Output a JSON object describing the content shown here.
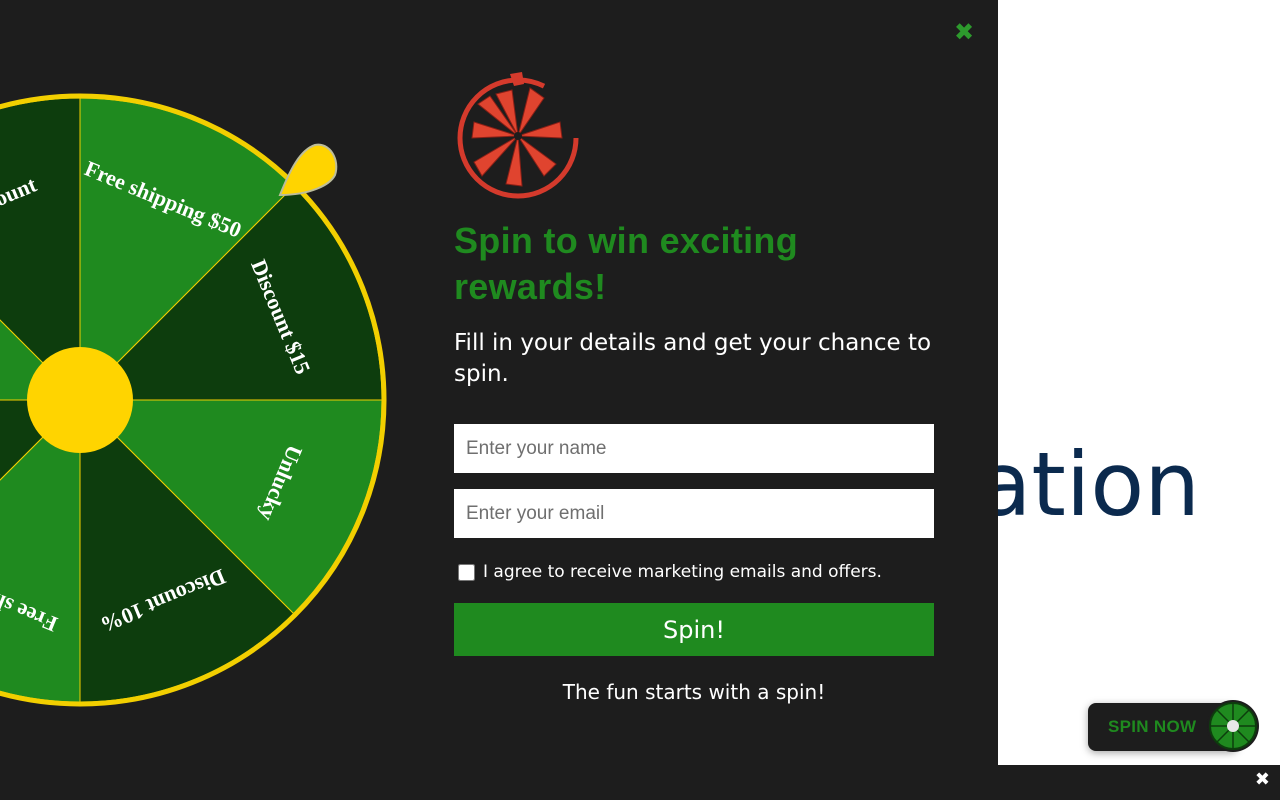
{
  "background": {
    "heading_fragment": "ation"
  },
  "popup": {
    "close_icon": "close-icon",
    "logo_icon": "wheel-logo-icon",
    "title": "Spin to win exciting rewards!",
    "subtitle": "Fill in your details and get your chance to spin.",
    "name_placeholder": "Enter your name",
    "name_value": "",
    "email_placeholder": "Enter your email",
    "email_value": "",
    "consent_checked": false,
    "consent_label": "I agree to receive marketing emails and offers.",
    "spin_button": "Spin!",
    "tagline": "The fun starts with a spin!"
  },
  "wheel": {
    "segments": [
      {
        "label": "Free shipping $50",
        "color": "#1f8a1f"
      },
      {
        "label": "Discount $15",
        "color": "#0d3d0d"
      },
      {
        "label": "Unlucky",
        "color": "#1f8a1f"
      },
      {
        "label": "Discount 10%",
        "color": "#0d3d0d"
      },
      {
        "label": "Free shipping",
        "color": "#1f8a1f"
      },
      {
        "label": "",
        "color": "#0d3d0d"
      },
      {
        "label": "",
        "color": "#1f8a1f"
      },
      {
        "label": "Discount",
        "color": "#0d3d0d"
      }
    ],
    "rim_color": "#f2cf00",
    "hub_color": "#ffd400",
    "pointer_color": "#ffd400"
  },
  "spin_now": {
    "label": "SPIN NOW",
    "icon": "mini-wheel-icon"
  },
  "bottom_bar": {
    "close_icon": "close-icon"
  },
  "colors": {
    "accent_green": "#1f8a1f",
    "dark_green": "#0d3d0d",
    "popup_bg": "#1d1d1d",
    "heading_blue": "#0b2a4e",
    "logo_red": "#d43a2c"
  }
}
